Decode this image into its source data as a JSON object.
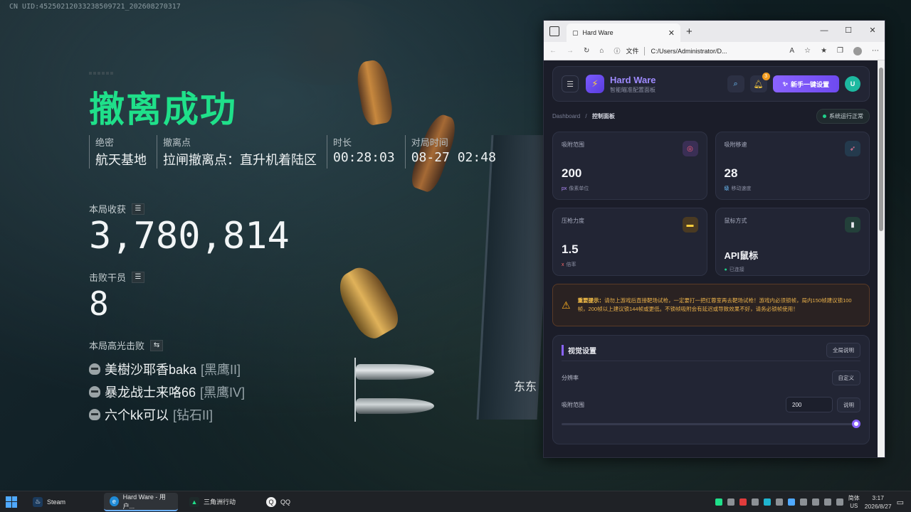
{
  "uid_text": "CN UID:4525021203323850972‍1_202608270317",
  "game": {
    "title": "撤离成功",
    "info": [
      {
        "label": "绝密",
        "value": "航天基地"
      },
      {
        "label": "撤离点",
        "value": "拉闸撤离点：直升机着陆区"
      },
      {
        "label": "时长",
        "value": "00:28:03"
      },
      {
        "label": "对局时间",
        "value": "08-27 02:48"
      }
    ],
    "earnings_label": "本局收获",
    "earnings_value": "3,780,814",
    "defeated_label": "击败干员",
    "defeated_value": "8",
    "highlight_label": "本局高光击败",
    "kills": [
      {
        "name": "美樹沙耶香baka",
        "rank": "[黑鹰II]"
      },
      {
        "name": "暴龙战士来咯66",
        "rank": "[黑鹰IV]"
      },
      {
        "name": "六个kk可以",
        "rank": "[钻石II]"
      }
    ],
    "side_text": "东东"
  },
  "browser": {
    "tab_title": "Hard Ware",
    "addr_file_label": "文件",
    "address": "C:/Users/Administrator/D...",
    "app": {
      "brand_title": "Hard Ware",
      "brand_sub": "智能瞄准配置面板",
      "notif_count": "3",
      "primary_label": "新手一键设置",
      "avatar_letter": "U",
      "breadcrumb_root": "Dashboard",
      "breadcrumb_sep": "/",
      "breadcrumb_current": "控制面板",
      "status_text": "系统运行正常",
      "cards": [
        {
          "title": "吸附范围",
          "value": "200",
          "unit_accent": "px",
          "unit": "像素单位",
          "icon": "target-icon",
          "icon_glyph": "◎",
          "accent": "#b48cff"
        },
        {
          "title": "吸附移速",
          "value": "28",
          "unit_accent": "级",
          "unit": "移动速度",
          "icon": "rocket-icon",
          "icon_glyph": "➶",
          "accent": "#6ec3ff"
        },
        {
          "title": "压枪力度",
          "value": "1.5",
          "unit_accent": "x",
          "unit": "倍率",
          "icon": "gun-icon",
          "icon_glyph": "▬",
          "accent": "#ff6b6b"
        },
        {
          "title": "鼠标方式",
          "value": "API鼠标",
          "unit_accent": "●",
          "unit": "已连接",
          "icon": "mouse-icon",
          "icon_glyph": "▮",
          "accent": "#1fd08a"
        }
      ],
      "warning_bold": "重要提示：",
      "warning_text": "请勿上游戏后直接靶场试枪，一定要打一把红蓉室再去靶场试枪！游戏内必须锁帧，局内150帧建议锁100帧，200帧以上建议锁144帧或更低。不锁帧吸附会有延迟或导致效果不好，请务必锁帧使用！",
      "settings": {
        "title": "视觉设置",
        "help_label": "全局说明",
        "rows": [
          {
            "label": "分辨率",
            "button": "自定义"
          },
          {
            "label": "吸附范围",
            "input_value": "200",
            "button": "说明"
          }
        ]
      }
    }
  },
  "taskbar": {
    "apps": [
      {
        "label": "Steam"
      },
      {
        "label": "Hard Ware - 用户..."
      },
      {
        "label": "三角洲行动"
      },
      {
        "label": "QQ"
      }
    ],
    "ime_line1": "简体",
    "ime_line2": "US",
    "time": "3:17",
    "date": "2026/8/27"
  }
}
